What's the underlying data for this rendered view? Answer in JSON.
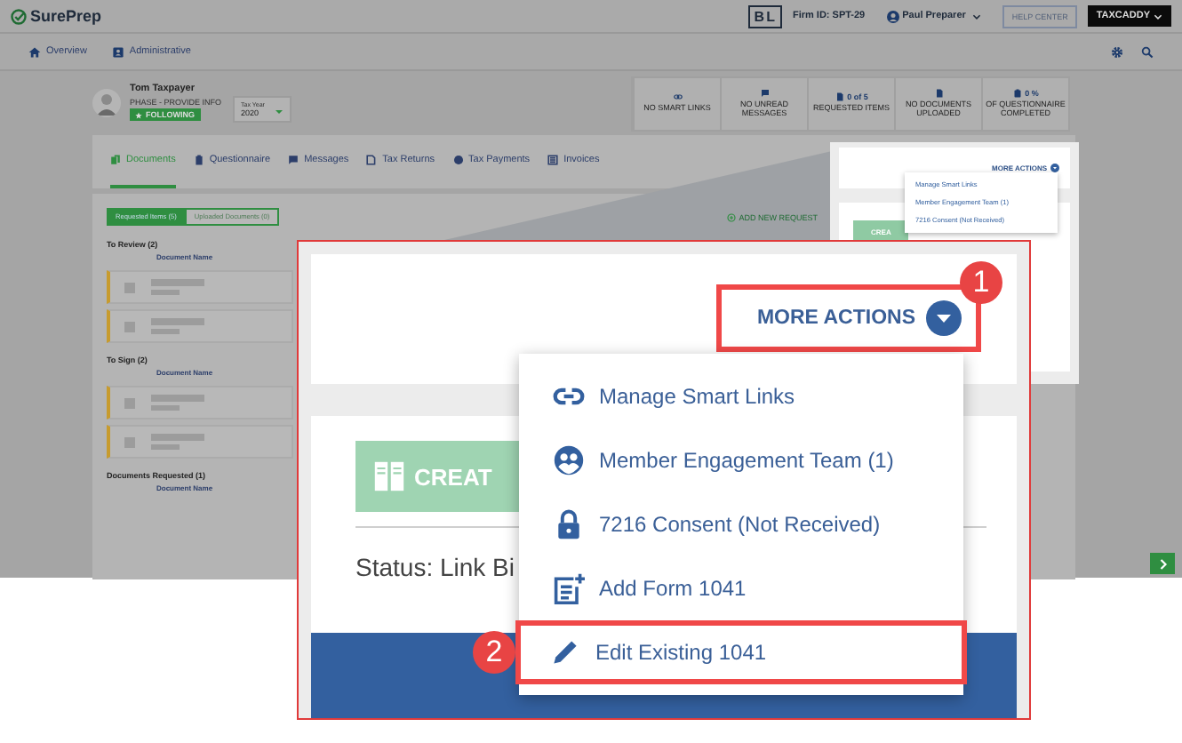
{
  "topbar": {
    "logo": "SurePrep",
    "firm_badge": "BL",
    "firm_id": "Firm ID: SPT-29",
    "user": "Paul Preparer",
    "help": "HELP CENTER",
    "product": "TAXCADDY"
  },
  "nav": [
    {
      "label": "Overview"
    },
    {
      "label": "Administrative"
    }
  ],
  "client": {
    "name": "Tom Taxpayer",
    "phase": "PHASE - PROVIDE INFO",
    "follow": "FOLLOWING",
    "tax_year_label": "Tax Year",
    "tax_year": "2020"
  },
  "stats": [
    {
      "label": "NO SMART LINKS"
    },
    {
      "label": "NO UNREAD MESSAGES"
    },
    {
      "value": "0 of 5",
      "label": "REQUESTED ITEMS"
    },
    {
      "label": "NO DOCUMENTS UPLOADED"
    },
    {
      "value": "0 %",
      "label": "OF QUESTIONNAIRE COMPLETED"
    }
  ],
  "tabs": [
    {
      "label": "Documents",
      "selected": true
    },
    {
      "label": "Questionnaire",
      "selected": false
    },
    {
      "label": "Messages",
      "selected": false
    },
    {
      "label": "Tax Returns",
      "selected": false
    },
    {
      "label": "Tax Payments",
      "selected": false
    },
    {
      "label": "Invoices",
      "selected": false
    }
  ],
  "doc_tabs": [
    {
      "label": "Requested Items (5)",
      "selected": true
    },
    {
      "label": "Uploaded Documents (0)",
      "selected": false
    }
  ],
  "add_request": "ADD NEW REQUEST",
  "sections": [
    {
      "title": "To Review (2)",
      "column": "Document Name",
      "rows": [
        {
          "kind": "redacted"
        },
        {
          "kind": "redacted"
        }
      ]
    },
    {
      "title": "To Sign (2)",
      "column": "Document Name",
      "rows": [
        {
          "kind": "redacted"
        },
        {
          "kind": "redacted"
        }
      ]
    },
    {
      "title": "Documents Requested (1)",
      "column": "Document Name"
    }
  ],
  "thumbnail": {
    "more_actions": "MORE ACTIONS",
    "button": "CREA",
    "menu": [
      {
        "label": "Manage Smart Links"
      },
      {
        "label": "Member Engagement Team (1)"
      },
      {
        "label": "7216 Consent (Not Received)"
      }
    ]
  },
  "callout": {
    "more_actions": {
      "label": "MORE ACTIONS",
      "highlighted": true,
      "step": "1"
    },
    "button": "CREAT",
    "status": "Status: Link Bi",
    "menu": [
      {
        "label": "Manage Smart Links",
        "highlighted": false
      },
      {
        "label": "Member Engagement Team (1)",
        "highlighted": false
      },
      {
        "label": "7216 Consent (Not Received)",
        "highlighted": false
      },
      {
        "label": "Add Form 1041",
        "highlighted": false
      },
      {
        "label": "Edit Existing 1041",
        "highlighted": true,
        "step": "2"
      }
    ]
  }
}
